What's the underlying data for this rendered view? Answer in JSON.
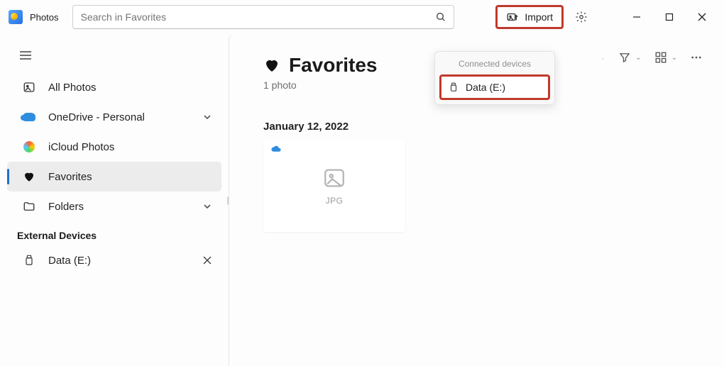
{
  "app": {
    "title": "Photos"
  },
  "search": {
    "placeholder": "Search in Favorites"
  },
  "import": {
    "label": "Import"
  },
  "dropdown": {
    "header": "Connected devices",
    "item": "Data (E:)"
  },
  "sidebar": {
    "all_photos": "All Photos",
    "onedrive": "OneDrive - Personal",
    "icloud": "iCloud Photos",
    "favorites": "Favorites",
    "folders": "Folders",
    "external_header": "External Devices",
    "data_e": "Data (E:)"
  },
  "page": {
    "title": "Favorites",
    "count": "1 photo",
    "date_group": "January 12, 2022",
    "thumb_ext": "JPG"
  }
}
